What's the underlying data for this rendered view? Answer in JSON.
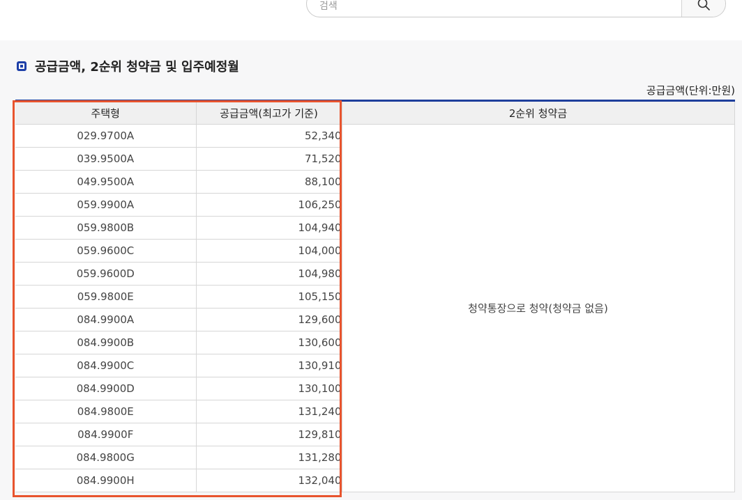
{
  "search": {
    "placeholder": "검색"
  },
  "section": {
    "title": "공급금액, 2순위 청약금 및 입주예정월"
  },
  "unit_note": "공급금액(단위:만원)",
  "table": {
    "headers": [
      "주택형",
      "공급금액(최고가 기준)",
      "2순위 청약금"
    ],
    "rows": [
      {
        "type": "029.9700A",
        "price": "52,340"
      },
      {
        "type": "039.9500A",
        "price": "71,520"
      },
      {
        "type": "049.9500A",
        "price": "88,100"
      },
      {
        "type": "059.9900A",
        "price": "106,250"
      },
      {
        "type": "059.9800B",
        "price": "104,940"
      },
      {
        "type": "059.9600C",
        "price": "104,000"
      },
      {
        "type": "059.9600D",
        "price": "104,980"
      },
      {
        "type": "059.9800E",
        "price": "105,150"
      },
      {
        "type": "084.9900A",
        "price": "129,600"
      },
      {
        "type": "084.9900B",
        "price": "130,600"
      },
      {
        "type": "084.9900C",
        "price": "130,910"
      },
      {
        "type": "084.9900D",
        "price": "130,100"
      },
      {
        "type": "084.9800E",
        "price": "131,240"
      },
      {
        "type": "084.9900F",
        "price": "129,810"
      },
      {
        "type": "084.9800G",
        "price": "131,280"
      },
      {
        "type": "084.9900H",
        "price": "132,040"
      }
    ],
    "subscription_note": "청약통장으로 청약(청약금 없음)"
  },
  "colors": {
    "highlight": "#e8542e",
    "header_rule": "#1e3f9c",
    "title_icon": "#1d3fa8"
  },
  "icons": {
    "search": "search-icon",
    "title": "square-bullet-icon"
  }
}
